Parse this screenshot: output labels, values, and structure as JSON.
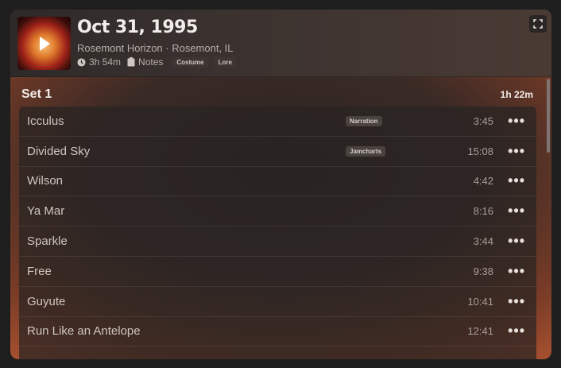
{
  "header": {
    "title": "Oct 31, 1995",
    "venue": "Rosemont Horizon · Rosemont, IL",
    "duration": "3h 54m",
    "notes_label": "Notes",
    "tags": [
      "Costume",
      "Lore"
    ]
  },
  "set": {
    "title": "Set 1",
    "duration": "1h 22m"
  },
  "tracks": [
    {
      "name": "Icculus",
      "tag": "Narration",
      "time": "3:45"
    },
    {
      "name": "Divided Sky",
      "tag": "Jamcharts",
      "time": "15:08"
    },
    {
      "name": "Wilson",
      "tag": "",
      "time": "4:42"
    },
    {
      "name": "Ya Mar",
      "tag": "",
      "time": "8:16"
    },
    {
      "name": "Sparkle",
      "tag": "",
      "time": "3:44"
    },
    {
      "name": "Free",
      "tag": "",
      "time": "9:38"
    },
    {
      "name": "Guyute",
      "tag": "",
      "time": "10:41"
    },
    {
      "name": "Run Like an Antelope",
      "tag": "",
      "time": "12:41"
    },
    {
      "name": "",
      "tag": "",
      "time": ""
    }
  ],
  "more_label": "•••",
  "icons": {
    "play": "play-icon",
    "clock": "clock-icon",
    "notes": "clipboard-icon",
    "expand": "expand-icon",
    "more": "more-dots-icon"
  }
}
